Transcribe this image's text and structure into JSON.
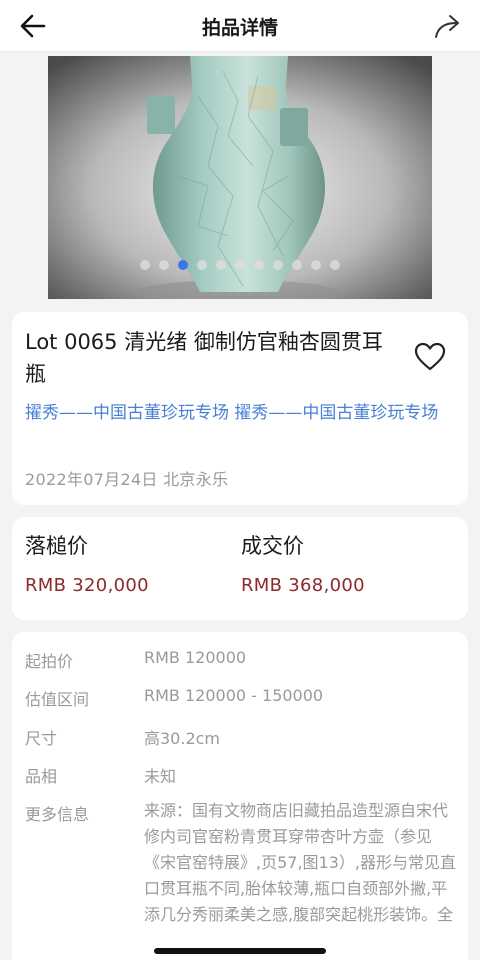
{
  "header": {
    "title": "拍品详情",
    "back_icon": "arrow-left-icon",
    "share_icon": "share-arrow-icon"
  },
  "carousel": {
    "image_subject": "celadon-crackle-vase",
    "total_slides": 11,
    "active_slide": 3
  },
  "lot": {
    "title": "Lot 0065 清光绪 御制仿官釉杏圆贯耳瓶",
    "session": "擢秀——中国古董珍玩专场 擢秀——中国古董珍玩专场",
    "date_place": "2022年07月24日 北京永乐",
    "favorite_icon": "heart-outline-icon"
  },
  "prices": {
    "hammer_label": "落槌价",
    "hammer_value": "RMB 320,000",
    "deal_label": "成交价",
    "deal_value": "RMB 368,000"
  },
  "details": {
    "start_label": "起拍价",
    "start_value": "RMB 120000",
    "estimate_label": "估值区间",
    "estimate_value": "RMB 120000 - 150000",
    "size_label": "尺寸",
    "size_value": "高30.2cm",
    "condition_label": "品相",
    "condition_value": "未知",
    "more_label": "更多信息",
    "more_value": "来源：国有文物商店旧藏拍品造型源自宋代修内司官窑粉青贯耳穿带杏叶方壶（参见《宋官窑特展》,页57,图13）,器形与常见直口贯耳瓶不同,胎体较薄,瓶口自颈部外撇,平添几分秀丽柔美之感,腹部突起桃形装饰。全"
  },
  "colors": {
    "link": "#4a7fd6",
    "price": "#8c2a2a",
    "muted": "#9a9a9a",
    "dot_active": "#3b76e8"
  }
}
